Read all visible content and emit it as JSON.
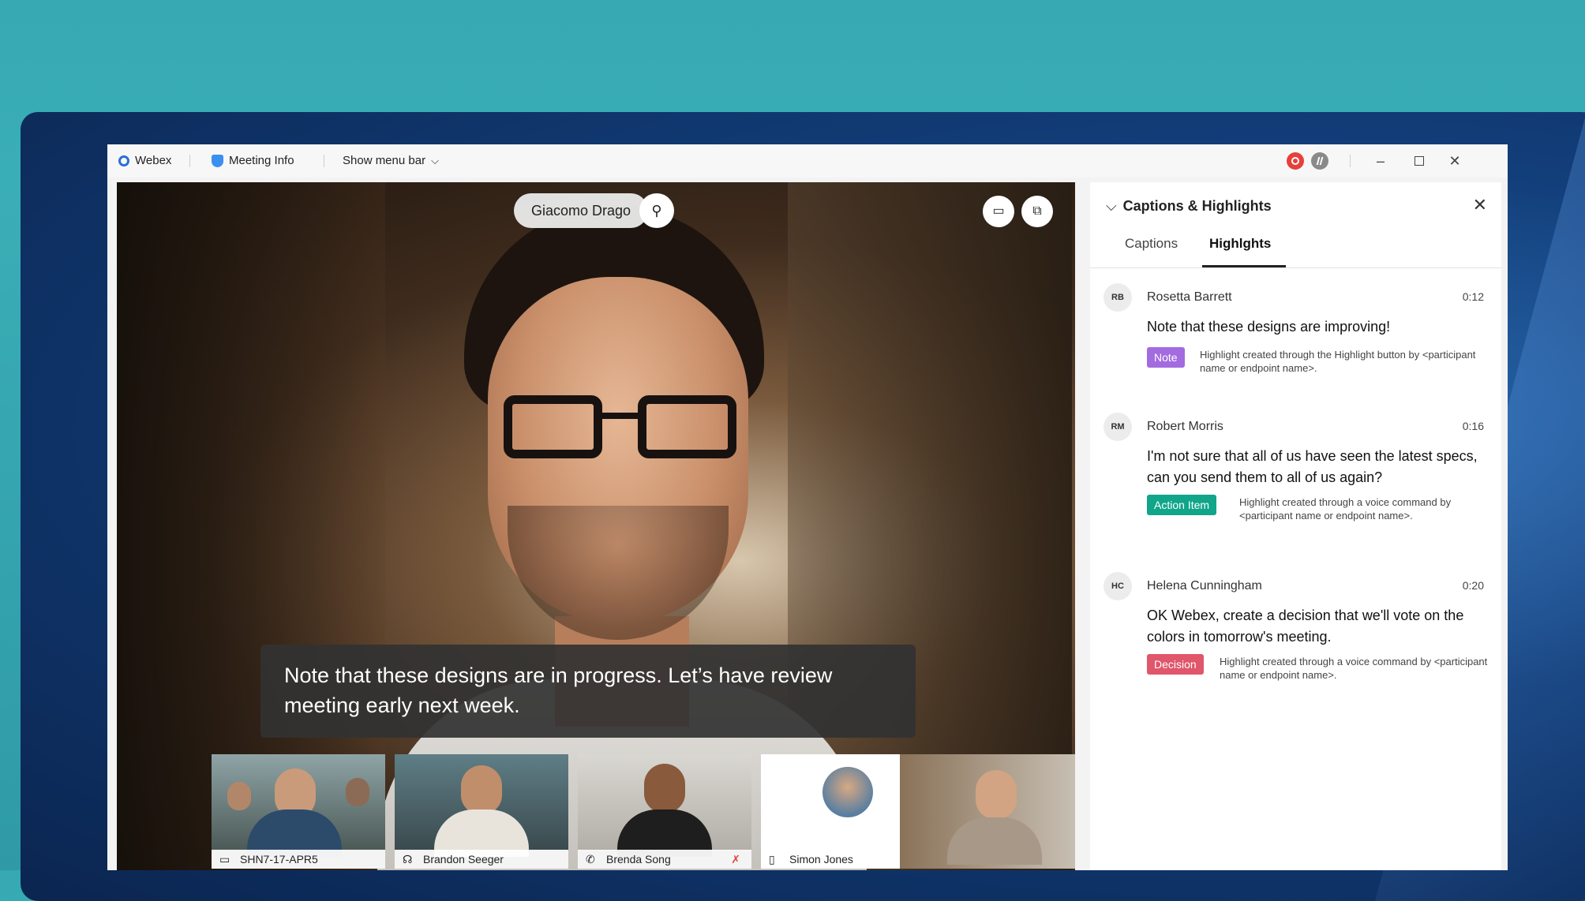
{
  "colors": {
    "background": "#36a9b2",
    "note_tag": "#a36be0",
    "action_tag": "#11a58a",
    "decision_tag": "#e0566a",
    "record_indicator": "#e5403b"
  },
  "titlebar": {
    "app_name": "Webex",
    "meeting_info": "Meeting Info",
    "show_menu_bar": "Show menu bar",
    "chevron": "⌵"
  },
  "video": {
    "active_speaker": "Giacomo Drago",
    "live_caption": "Note that these designs are in progress. Let’s have review meeting early next week."
  },
  "participants": [
    {
      "name": "SHN7-17-APR5",
      "icon": "tv-icon"
    },
    {
      "name": "Brandon Seeger",
      "icon": "headset-icon"
    },
    {
      "name": "Brenda Song",
      "icon": "phone-icon"
    },
    {
      "name": "Simon Jones",
      "icon": "mobile-icon"
    }
  ],
  "panel": {
    "title": "Captions & Highlights",
    "tabs": [
      {
        "label": "Captions",
        "active": false
      },
      {
        "label": "Highlghts",
        "active": true
      }
    ],
    "highlights": [
      {
        "initials": "RB",
        "name": "Rosetta Barrett",
        "time": "0:12",
        "text": "Note that these designs are improving!",
        "tag": "Note",
        "tag_color": "#a36be0",
        "description": "Highlight created through the Highlight button by <participant name or endpoint name>."
      },
      {
        "initials": "RM",
        "name": "Robert Morris",
        "time": "0:16",
        "text": "I'm not sure that all of us have seen the latest specs, can you send them to all of us again?",
        "tag": "Action Item",
        "tag_color": "#11a58a",
        "description": "Highlight created through a voice command by <participant name or endpoint name>."
      },
      {
        "initials": "HC",
        "name": "Helena Cunningham",
        "time": "0:20",
        "text": "OK Webex, create a decision that we'll vote on the colors in tomorrow's meeting.",
        "tag": "Decision",
        "tag_color": "#e0566a",
        "description": "Highlight created through a voice command by <participant name or endpoint name>."
      }
    ]
  }
}
